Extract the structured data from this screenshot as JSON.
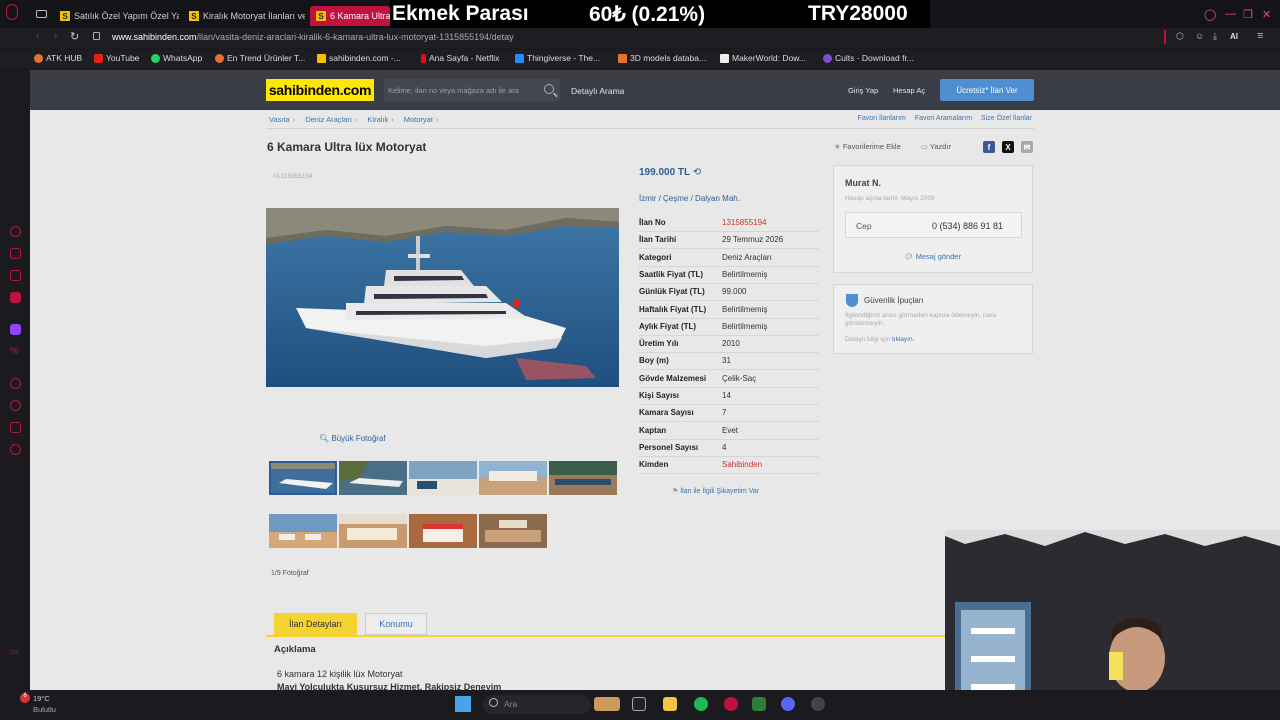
{
  "browser": {
    "tabs": [
      {
        "label": "Satılık Özel Yapım Özel Yap",
        "active": false
      },
      {
        "label": "Kiralık Motoryat İlanları ve",
        "active": false
      },
      {
        "label": "6 Kamara Ultra",
        "active": true
      }
    ],
    "url_domain": "www.sahibinden.com",
    "url_path": "/ilan/vasita-deniz-araclari-kiralik-6-kamara-ultra-lux-motoryat-1315855194/detay",
    "bookmarks": [
      "ATK HUB",
      "YouTube",
      "WhatsApp",
      "En Trend Ürünler T...",
      "sahibinden.com -...",
      "Ana Sayfa - Netflix",
      "Thingiverse - The...",
      "3D models databa...",
      "MakerWorld: Dow...",
      "Cults · Download fr..."
    ],
    "ai_label": "AI"
  },
  "stream_overlay": {
    "label": "Ekmek Parası",
    "rate": "60₺ (0.21%)",
    "total": "TRY28000"
  },
  "site": {
    "logo": "sahibinden.com",
    "search_placeholder": "Kelime, ilan no veya mağaza adı ile ara",
    "detailed_search": "Detaylı Arama",
    "login": "Giriş Yap",
    "register": "Hesap Aç",
    "post_ad": "Ücretsiz* İlan Ver"
  },
  "breadcrumb": [
    "Vasıta",
    "Deniz Araçları",
    "Kiralık",
    "Motoryat"
  ],
  "right_links": [
    "Favori İlanlarım",
    "Favori Aramalarım",
    "Size Özel İlanlar"
  ],
  "listing": {
    "title": "6 Kamara Ultra lüx Motoryat",
    "id_small": "#1315855194",
    "add_favorites": "Favorilerime Ekle",
    "print": "Yazdır",
    "price": "199.000 TL",
    "location": [
      "İzmir",
      "Çeşme",
      "Dalyan Mah."
    ],
    "details": [
      {
        "k": "İlan No",
        "v": "1315855194",
        "red": true
      },
      {
        "k": "İlan Tarihi",
        "v": "29 Temmuz 2026"
      },
      {
        "k": "Kategori",
        "v": "Deniz Araçları"
      },
      {
        "k": "Saatlik Fiyat (TL)",
        "v": "Belirtilmemiş"
      },
      {
        "k": "Günlük Fiyat (TL)",
        "v": "99.000"
      },
      {
        "k": "Haftalık Fiyat (TL)",
        "v": "Belirtilmemiş"
      },
      {
        "k": "Aylık Fiyat (TL)",
        "v": "Belirtilmemiş"
      },
      {
        "k": "Üretim Yılı",
        "v": "2010"
      },
      {
        "k": "Boy (m)",
        "v": "31"
      },
      {
        "k": "Gövde Malzemesi",
        "v": "Çelik-Saç"
      },
      {
        "k": "Kişi Sayısı",
        "v": "14"
      },
      {
        "k": "Kamara Sayısı",
        "v": "7"
      },
      {
        "k": "Kaptan",
        "v": "Evet"
      },
      {
        "k": "Personel Sayısı",
        "v": "4"
      },
      {
        "k": "Kimden",
        "v": "Sahibinden",
        "red": true
      }
    ],
    "complain": "İlan ile İlgili Şikayetim Var",
    "big_photo": "Büyük Fotoğraf",
    "photo_count": "1/9 Fotoğraf"
  },
  "seller": {
    "name": "Murat N.",
    "since": "Hesap açma tarihi: Mayıs 2009",
    "phone_label": "Cep",
    "phone": "0 (534) 886 91 81",
    "message": "Mesaj gönder"
  },
  "safety": {
    "title": "Güvenlik İpuçları",
    "text": "İlgilendiğiniz aracı görmeden kapora ödemeyin, para göndermeyin.",
    "link_pre": "Detaylı bilgi için",
    "link": "tıklayın."
  },
  "tabs": {
    "details": "İlan Detayları",
    "location": "Konumu"
  },
  "description": {
    "heading": "Açıklama",
    "line1": "6 kamara 12 kişilik lüx Motoryat",
    "line2": "Mavi Yolculukta Kusursuz Hizmet, Rakipsiz Deneyim"
  },
  "taskbar": {
    "temp": "19°C",
    "condition": "Bulutlu",
    "search": "Ara"
  },
  "colors": {
    "brand_yellow": "#ffe800",
    "accent_red": "#c1123f",
    "link_blue": "#3b73b0"
  }
}
